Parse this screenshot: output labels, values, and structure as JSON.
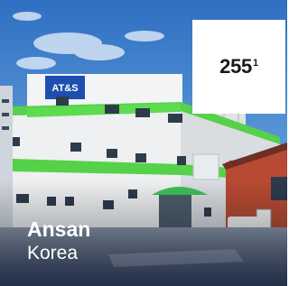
{
  "location_card": {
    "image_alt": "AT&S plant building",
    "building_sign": "AT&S",
    "badge": {
      "value": "255",
      "footnote": "1"
    },
    "city": "Ansan",
    "country": "Korea"
  }
}
